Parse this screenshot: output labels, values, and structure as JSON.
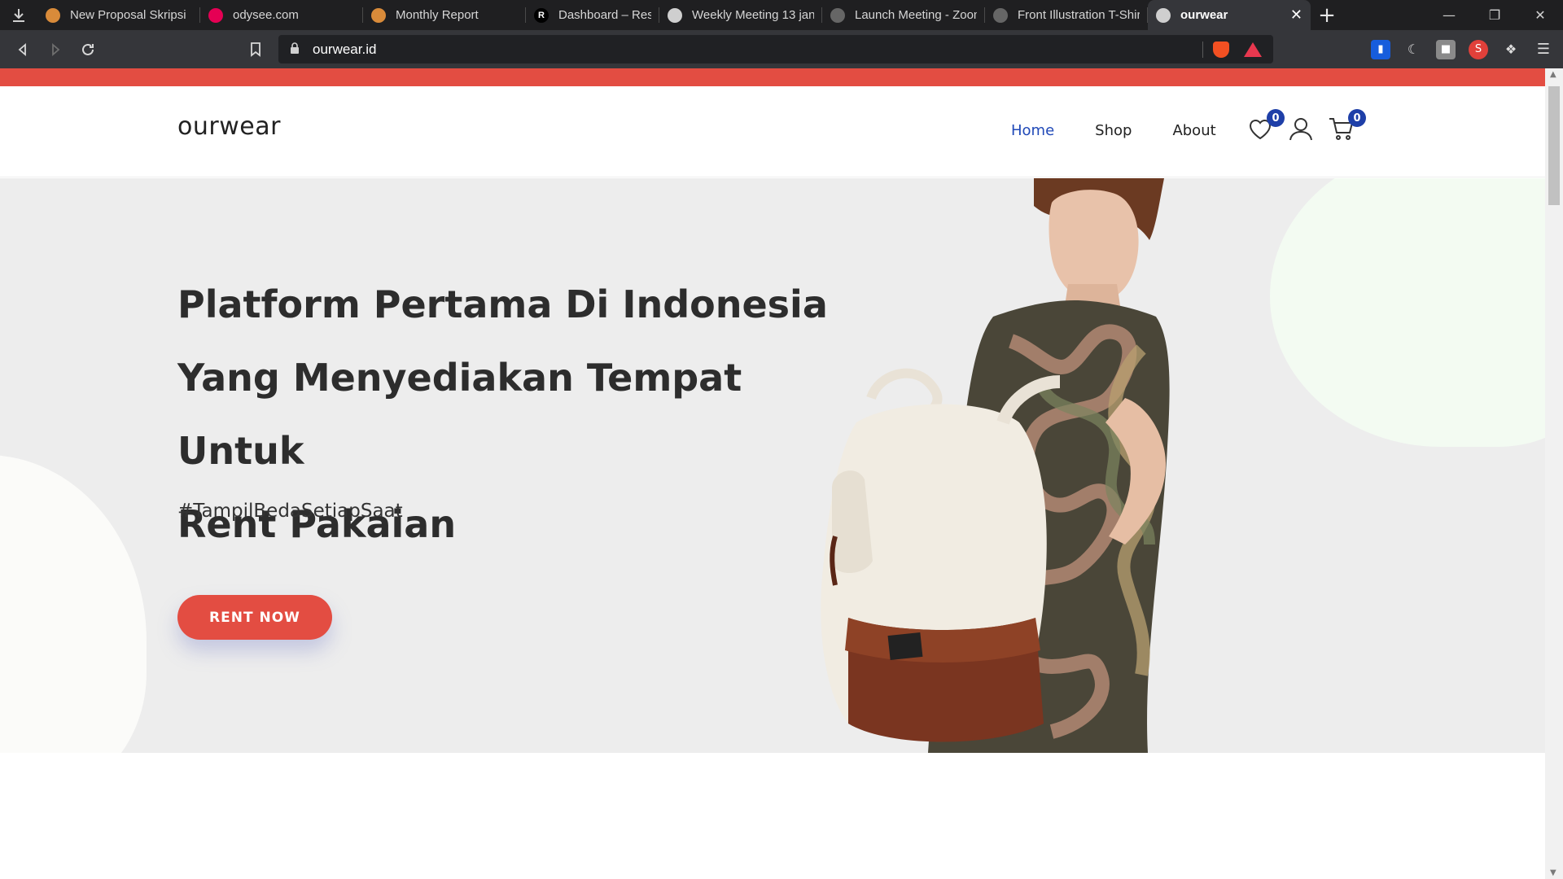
{
  "browser": {
    "tabs": [
      {
        "title": "New Proposal Skripsi",
        "favicon_color": "#d98b3a"
      },
      {
        "title": "odysee.com",
        "favicon_color": "#e50054"
      },
      {
        "title": "Monthly Report",
        "favicon_color": "#d98b3a"
      },
      {
        "title": "Dashboard – Restream",
        "favicon_color": "#000000",
        "favicon_letter": "R"
      },
      {
        "title": "Weekly Meeting 13 jan",
        "favicon_color": "#cfcfcf"
      },
      {
        "title": "Launch Meeting - Zoom",
        "favicon_color": "#666666"
      },
      {
        "title": "Front Illustration T-Shirt",
        "favicon_color": "#666666"
      },
      {
        "title": "ourwear",
        "favicon_color": "#cfcfcf",
        "active": true
      }
    ],
    "url": "ourwear.id"
  },
  "site": {
    "logo": "ourwear",
    "nav": {
      "home": "Home",
      "shop": "Shop",
      "about": "About"
    },
    "wishlist_count": "0",
    "cart_count": "0",
    "hero": {
      "title_line1": "Platform Pertama Di Indonesia",
      "title_line2": "Yang Menyediakan Tempat Untuk",
      "title_line3": "Rent Pakaian",
      "subtitle": "#TampilBedaSetiapSaat",
      "cta": "RENT NOW"
    },
    "accent_color": "#e34d42",
    "nav_active_color": "#2049b8"
  }
}
